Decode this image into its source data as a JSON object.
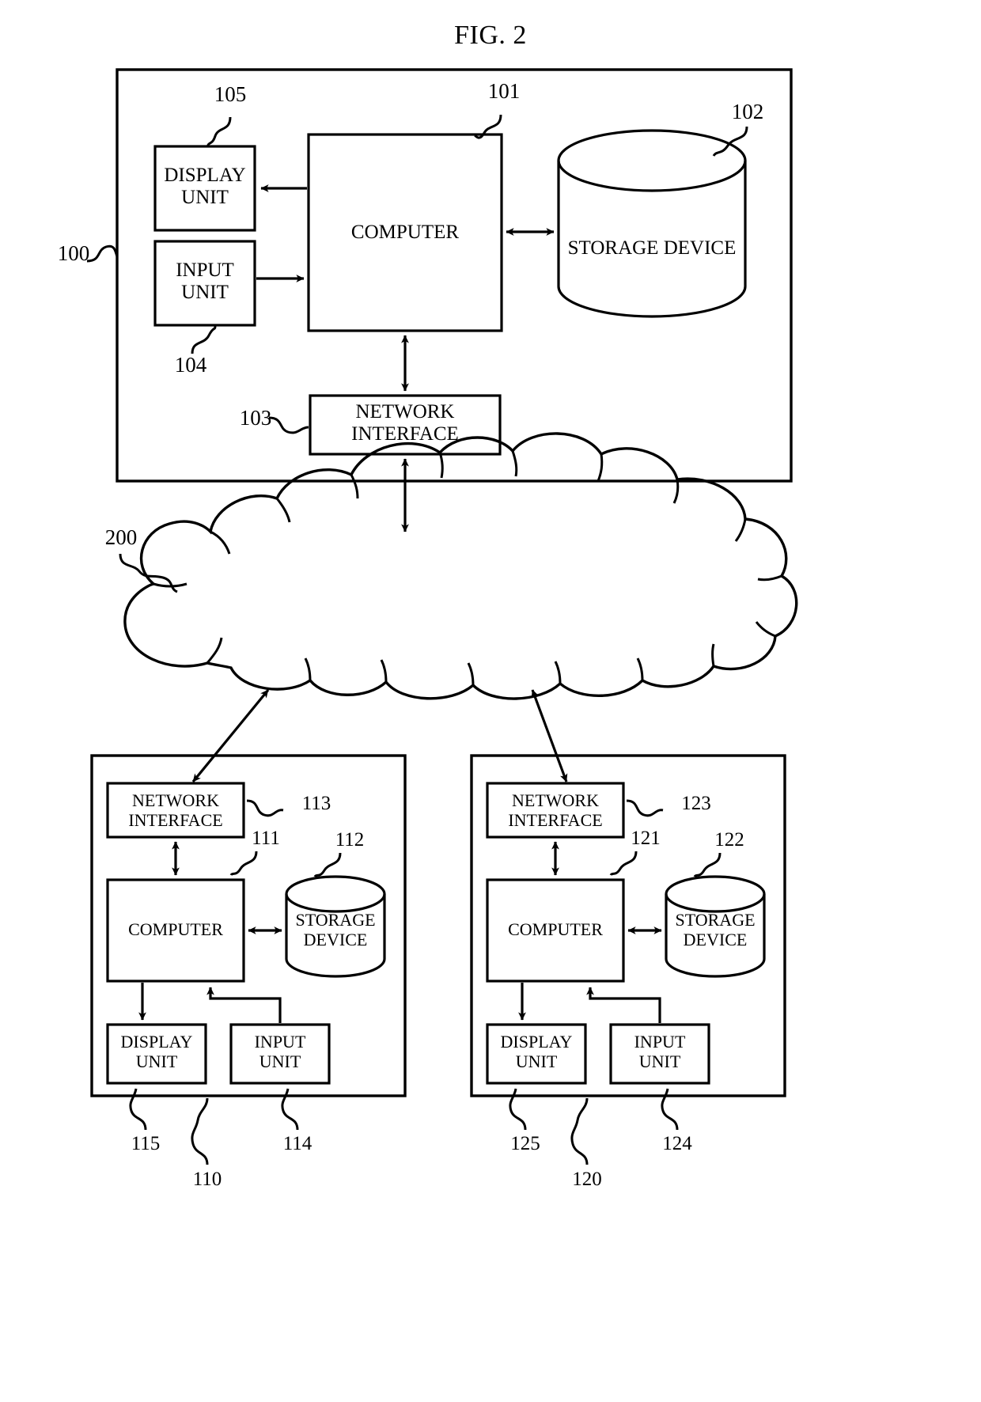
{
  "figure": {
    "title": "FIG. 2",
    "type": "patent-system-block-diagram"
  },
  "system_100": {
    "ref": "100",
    "computer": {
      "label": "COMPUTER",
      "ref": "101"
    },
    "storage": {
      "label": "STORAGE DEVICE",
      "ref": "102"
    },
    "network_interface": {
      "label": "NETWORK\nINTERFACE",
      "ref": "103"
    },
    "input_unit": {
      "label": "INPUT\nUNIT",
      "ref": "104"
    },
    "display_unit": {
      "label": "DISPLAY\nUNIT",
      "ref": "105"
    }
  },
  "network_200": {
    "ref": "200",
    "shape": "cloud"
  },
  "terminal_110": {
    "ref": "110",
    "computer": {
      "label": "COMPUTER",
      "ref": "111"
    },
    "storage": {
      "label": "STORAGE\nDEVICE",
      "ref": "112"
    },
    "network_interface": {
      "label": "NETWORK\nINTERFACE",
      "ref": "113"
    },
    "input_unit": {
      "label": "INPUT\nUNIT",
      "ref": "114"
    },
    "display_unit": {
      "label": "DISPLAY\nUNIT",
      "ref": "115"
    }
  },
  "terminal_120": {
    "ref": "120",
    "computer": {
      "label": "COMPUTER",
      "ref": "121"
    },
    "storage": {
      "label": "STORAGE\nDEVICE",
      "ref": "122"
    },
    "network_interface": {
      "label": "NETWORK\nINTERFACE",
      "ref": "123"
    },
    "input_unit": {
      "label": "INPUT\nUNIT",
      "ref": "124"
    },
    "display_unit": {
      "label": "DISPLAY\nUNIT",
      "ref": "125"
    }
  },
  "colors": {
    "ink": "#000000",
    "paper": "#ffffff"
  }
}
